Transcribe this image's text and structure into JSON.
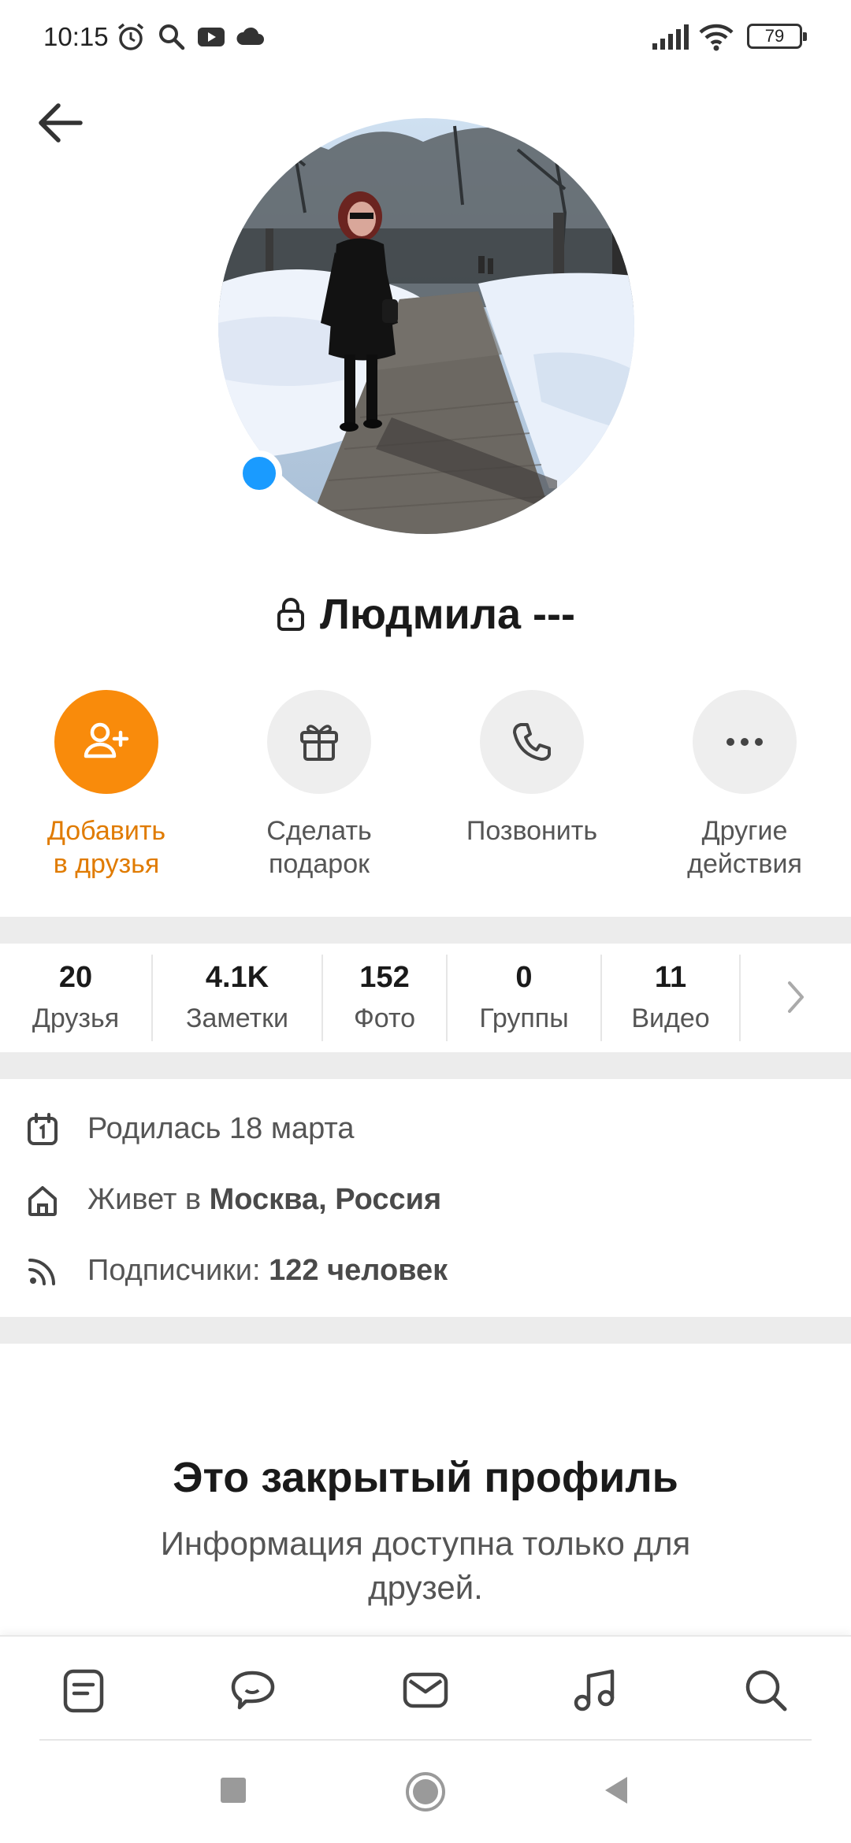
{
  "status_bar": {
    "time": "10:15",
    "battery": "79"
  },
  "header": {
    "back_icon": "arrow-left-icon"
  },
  "profile": {
    "name": "Людмила ---",
    "online_color": "#1a9bff",
    "lock_icon": "lock-icon"
  },
  "actions": [
    {
      "label_line1": "Добавить",
      "label_line2": "в друзья",
      "icon": "add-user-icon"
    },
    {
      "label_line1": "Сделать",
      "label_line2": "подарок",
      "icon": "gift-icon"
    },
    {
      "label_line1": "Позвонить",
      "label_line2": "",
      "icon": "phone-icon"
    },
    {
      "label_line1": "Другие",
      "label_line2": "действия",
      "icon": "more-icon"
    }
  ],
  "stats": [
    {
      "count": "20",
      "label": "Друзья"
    },
    {
      "count": "4.1K",
      "label": "Заметки"
    },
    {
      "count": "152",
      "label": "Фото"
    },
    {
      "count": "0",
      "label": "Группы"
    },
    {
      "count": "11",
      "label": "Видео"
    }
  ],
  "info": {
    "birthday": "Родилась 18 марта",
    "lives_prefix": "Живет в ",
    "lives_city": "Москва, Россия",
    "followers_prefix": "Подписчики: ",
    "followers_count": "122 человек"
  },
  "closed_profile": {
    "title": "Это закрытый профиль",
    "text": "Информация доступна только для друзей."
  },
  "bottom_nav": [
    "feed-icon",
    "discussions-icon",
    "messages-icon",
    "music-icon",
    "search-icon"
  ],
  "colors": {
    "accent": "#f98b0b",
    "accent_text": "#e07b00",
    "online": "#1a9bff",
    "divider": "#ececec"
  }
}
